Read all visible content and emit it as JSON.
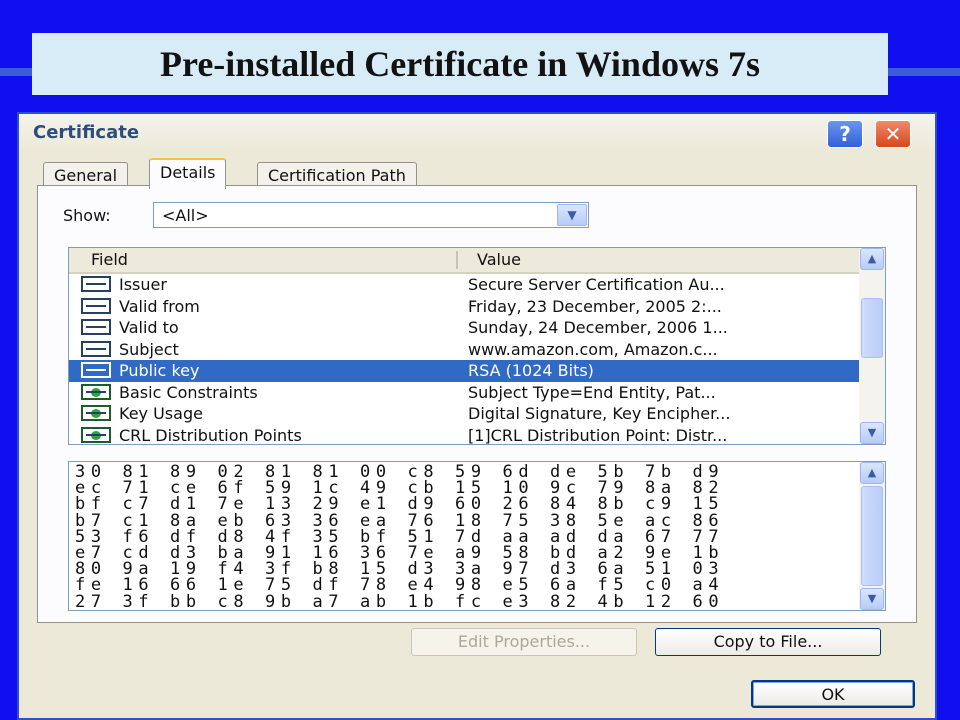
{
  "slide": {
    "title": "Pre-installed Certificate in Windows 7s"
  },
  "window": {
    "title": "Certificate",
    "help_symbol": "?",
    "close_symbol": "✕"
  },
  "tabs": [
    {
      "label": "General",
      "active": false
    },
    {
      "label": "Details",
      "active": true
    },
    {
      "label": "Certification Path",
      "active": false
    }
  ],
  "show": {
    "label": "Show:",
    "value": "<All>"
  },
  "fields_list": {
    "columns": {
      "field": "Field",
      "value": "Value"
    },
    "rows": [
      {
        "icon": "certificate-field-icon",
        "field": "Issuer",
        "value": "Secure Server Certification Au...",
        "selected": false
      },
      {
        "icon": "certificate-field-icon",
        "field": "Valid from",
        "value": "Friday, 23 December, 2005 2:...",
        "selected": false
      },
      {
        "icon": "certificate-field-icon",
        "field": "Valid to",
        "value": "Sunday, 24 December, 2006 1...",
        "selected": false
      },
      {
        "icon": "certificate-field-icon",
        "field": "Subject",
        "value": "www.amazon.com, Amazon.c...",
        "selected": false
      },
      {
        "icon": "certificate-field-icon",
        "field": "Public key",
        "value": "RSA (1024 Bits)",
        "selected": true
      },
      {
        "icon": "certificate-extension-icon",
        "field": "Basic Constraints",
        "value": "Subject Type=End Entity, Pat...",
        "selected": false
      },
      {
        "icon": "certificate-extension-icon",
        "field": "Key Usage",
        "value": "Digital Signature, Key Encipher...",
        "selected": false
      },
      {
        "icon": "certificate-extension-icon",
        "field": "CRL Distribution Points",
        "value": "[1]CRL Distribution Point: Distr...",
        "selected": false
      }
    ]
  },
  "public_key_hex": [
    "30 81 89 02 81 81 00 c8 59 6d de 5b 7b d9",
    "ec 71 ce 6f 59 1c 49 cb 15 10 9c 79 8a 82",
    "bf c7 d1 7e 13 29 e1 d9 60 26 84 8b c9 15",
    "b7 c1 8a eb 63 36 ea 76 18 75 38 5e ac 86",
    "53 f6 df d8 4f 35 bf 51 7d aa ad da 67 77",
    "e7 cd d3 ba 91 16 36 7e a9 58 bd a2 9e 1b",
    "80 9a 19 f4 3f b8 15 d3 3a 97 d3 6a 51 03",
    "fe 16 66 1e 75 df 78 e4 98 e5 6a f5 c0 a4",
    "27 3f bb c8 9b a7 ab 1b fc e3 82 4b 12 60"
  ],
  "buttons": {
    "edit_properties": "Edit Properties...",
    "copy_to_file": "Copy to File...",
    "ok": "OK"
  },
  "scroll_arrows": {
    "up": "▲",
    "down": "▼",
    "dropdown": "▼"
  }
}
